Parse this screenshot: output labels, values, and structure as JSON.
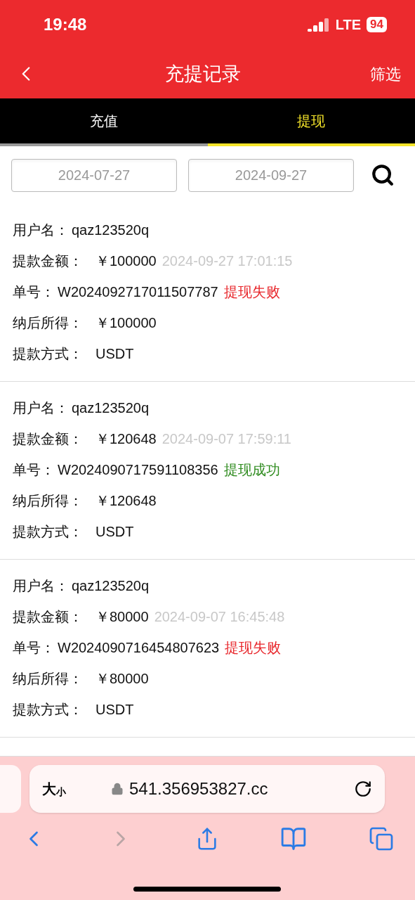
{
  "status_bar": {
    "time": "19:48",
    "network": "LTE",
    "battery": "94"
  },
  "header": {
    "title": "充提记录",
    "action": "筛选"
  },
  "tabs": [
    {
      "label": "充值",
      "selected": false
    },
    {
      "label": "提现",
      "selected": true
    }
  ],
  "filter": {
    "start_date": "2024-07-27",
    "end_date": "2024-09-27"
  },
  "records": [
    {
      "username_label": "用户名：",
      "username": "qaz123520q",
      "amount_label": "提款金额：",
      "amount": "￥100000",
      "time": "2024-09-27 17:01:15",
      "order_label": "单号：",
      "order": "W2024092717011507787",
      "status": "提现失败",
      "kind": "failed",
      "net_label": "纳后所得：",
      "net": "￥100000",
      "method_label": "提款方式：",
      "method": "USDT"
    },
    {
      "username_label": "用户名：",
      "username": "qaz123520q",
      "amount_label": "提款金额：",
      "amount": "￥120648",
      "time": "2024-09-07 17:59:11",
      "order_label": "单号：",
      "order": "W2024090717591108356",
      "status": "提现成功",
      "kind": "success",
      "net_label": "纳后所得：",
      "net": "￥120648",
      "method_label": "提款方式：",
      "method": "USDT"
    },
    {
      "username_label": "用户名：",
      "username": "qaz123520q",
      "amount_label": "提款金额：",
      "amount": "￥80000",
      "time": "2024-09-07 16:45:48",
      "order_label": "单号：",
      "order": "W2024090716454807623",
      "status": "提现失败",
      "kind": "failed",
      "net_label": "纳后所得：",
      "net": "￥80000",
      "method_label": "提款方式：",
      "method": "USDT"
    }
  ],
  "browser": {
    "text_size_big": "大",
    "text_size_small": "小",
    "url": "541.356953827.cc"
  }
}
